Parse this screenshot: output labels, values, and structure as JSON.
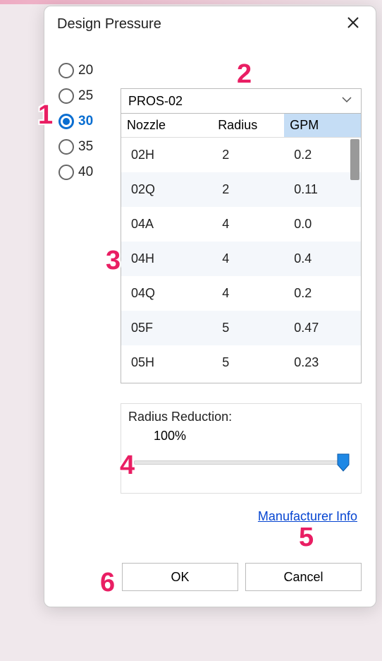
{
  "dialog": {
    "title": "Design Pressure"
  },
  "pressures": {
    "options": [
      "20",
      "25",
      "30",
      "35",
      "40"
    ],
    "selected_index": 2
  },
  "dropdown": {
    "selected": "PROS-02"
  },
  "table": {
    "headers": [
      "Nozzle",
      "Radius",
      "GPM"
    ],
    "sorted_col": 2,
    "rows": [
      {
        "nozzle": "02H",
        "radius": "2",
        "gpm": "0.2"
      },
      {
        "nozzle": "02Q",
        "radius": "2",
        "gpm": "0.11"
      },
      {
        "nozzle": "04A",
        "radius": "4",
        "gpm": "0.0"
      },
      {
        "nozzle": "04H",
        "radius": "4",
        "gpm": "0.4"
      },
      {
        "nozzle": "04Q",
        "radius": "4",
        "gpm": "0.2"
      },
      {
        "nozzle": "05F",
        "radius": "5",
        "gpm": "0.47"
      },
      {
        "nozzle": "05H",
        "radius": "5",
        "gpm": "0.23"
      }
    ]
  },
  "reduction": {
    "label": "Radius Reduction:",
    "value": "100%"
  },
  "links": {
    "manufacturer": "Manufacturer Info"
  },
  "buttons": {
    "ok": "OK",
    "cancel": "Cancel"
  },
  "annotations": {
    "1": "1",
    "2": "2",
    "3": "3",
    "4": "4",
    "5": "5",
    "6": "6"
  }
}
